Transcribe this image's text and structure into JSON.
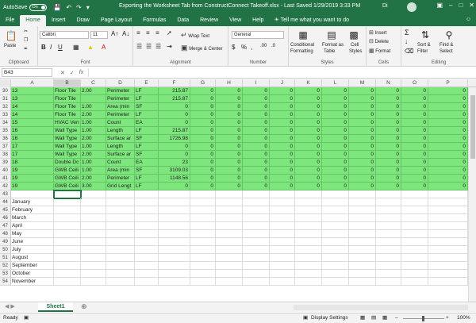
{
  "titlebar": {
    "autosave_label": "AutoSave",
    "autosave_state": "On",
    "title": "Exporting the Worksheet Tab from ConstructConnect Takeoff.xlsx  -  Last Saved 1/29/2019 3:33 PM",
    "user": "Di"
  },
  "menu": {
    "tabs": [
      "File",
      "Home",
      "Insert",
      "Draw",
      "Page Layout",
      "Formulas",
      "Data",
      "Review",
      "View",
      "Help"
    ],
    "tell_me": "Tell me what you want to do"
  },
  "ribbon": {
    "clipboard": {
      "label": "Clipboard",
      "paste": "Paste"
    },
    "font": {
      "label": "Font",
      "font_name": "Calibri",
      "font_size": "11"
    },
    "alignment": {
      "label": "Alignment",
      "wrap": "Wrap Text",
      "merge": "Merge & Center"
    },
    "number": {
      "label": "Number",
      "format": "General"
    },
    "styles": {
      "label": "Styles",
      "conditional": "Conditional",
      "conditional2": "Formatting",
      "format_table": "Format as",
      "format_table2": "Table",
      "cell_styles": "Cell",
      "cell_styles2": "Styles"
    },
    "cells": {
      "label": "Cells",
      "insert": "Insert",
      "delete": "Delete",
      "format": "Format"
    },
    "editing": {
      "label": "Editing",
      "sort": "Sort &",
      "sort2": "Filter",
      "find": "Find &",
      "find2": "Select"
    }
  },
  "formula_bar": {
    "name_box": "B43",
    "fx": "fx"
  },
  "columns": [
    "A",
    "B",
    "C",
    "D",
    "E",
    "F",
    "G",
    "H",
    "I",
    "J",
    "K",
    "L",
    "M",
    "N",
    "O",
    "P"
  ],
  "green_rows": [
    {
      "n": "30",
      "a": "13",
      "b": "Floor Tile",
      "c": "2.00",
      "d": "Perimeter",
      "e": "LF",
      "f": "215.87"
    },
    {
      "n": "31",
      "a": "13",
      "b": "Floor Tile",
      "c": "",
      "d": "Perimeter",
      "e": "LF",
      "f": "215.87"
    },
    {
      "n": "32",
      "a": "14",
      "b": "Floor Tile",
      "c": "1.00",
      "d": "Area (min",
      "e": "SF",
      "f": "0"
    },
    {
      "n": "33",
      "a": "14",
      "b": "Floor Tile",
      "c": "2.00",
      "d": "Perimeter",
      "e": "LF",
      "f": "0"
    },
    {
      "n": "34",
      "a": "15",
      "b": "HVAC Ven",
      "c": "1.00",
      "d": "Count",
      "e": "EA",
      "f": "0"
    },
    {
      "n": "35",
      "a": "16",
      "b": "Wall Type",
      "c": "1.00",
      "d": "Length",
      "e": "LF",
      "f": "215.87"
    },
    {
      "n": "36",
      "a": "16",
      "b": "Wall Type",
      "c": "2.00",
      "d": "Surface ar",
      "e": "SF",
      "f": "1726.98"
    },
    {
      "n": "37",
      "a": "17",
      "b": "Wall Type",
      "c": "1.00",
      "d": "Length",
      "e": "LF",
      "f": "0"
    },
    {
      "n": "38",
      "a": "17",
      "b": "Wall Type",
      "c": "2.00",
      "d": "Surface ar",
      "e": "SF",
      "f": "0"
    },
    {
      "n": "39",
      "a": "18",
      "b": "Double Dc",
      "c": "1.00",
      "d": "Count",
      "e": "EA",
      "f": "23"
    },
    {
      "n": "40",
      "a": "19",
      "b": "GWB Ceili",
      "c": "1.00",
      "d": "Area (min",
      "e": "SF",
      "f": "3109.03"
    },
    {
      "n": "41",
      "a": "19",
      "b": "GWB Ceili",
      "c": "2.00",
      "d": "Perimeter",
      "e": "LF",
      "f": "1148.56"
    },
    {
      "n": "42",
      "a": "19",
      "b": "GWB Ceili",
      "c": "3.00",
      "d": "Grid Lengt",
      "e": "LF",
      "f": "0"
    }
  ],
  "zero_value": "0",
  "empty_rows": [
    {
      "n": "43",
      "a": ""
    },
    {
      "n": "44",
      "a": "January"
    },
    {
      "n": "45",
      "a": "February"
    },
    {
      "n": "46",
      "a": "March"
    },
    {
      "n": "47",
      "a": "April"
    },
    {
      "n": "48",
      "a": "May"
    },
    {
      "n": "49",
      "a": "June"
    },
    {
      "n": "50",
      "a": "July"
    },
    {
      "n": "51",
      "a": "August"
    },
    {
      "n": "52",
      "a": "September"
    },
    {
      "n": "53",
      "a": "October"
    },
    {
      "n": "54",
      "a": "November"
    }
  ],
  "sheet": {
    "tab": "Sheet1"
  },
  "status": {
    "left": "Ready",
    "display_settings": "Display Settings",
    "zoom": "100%"
  }
}
